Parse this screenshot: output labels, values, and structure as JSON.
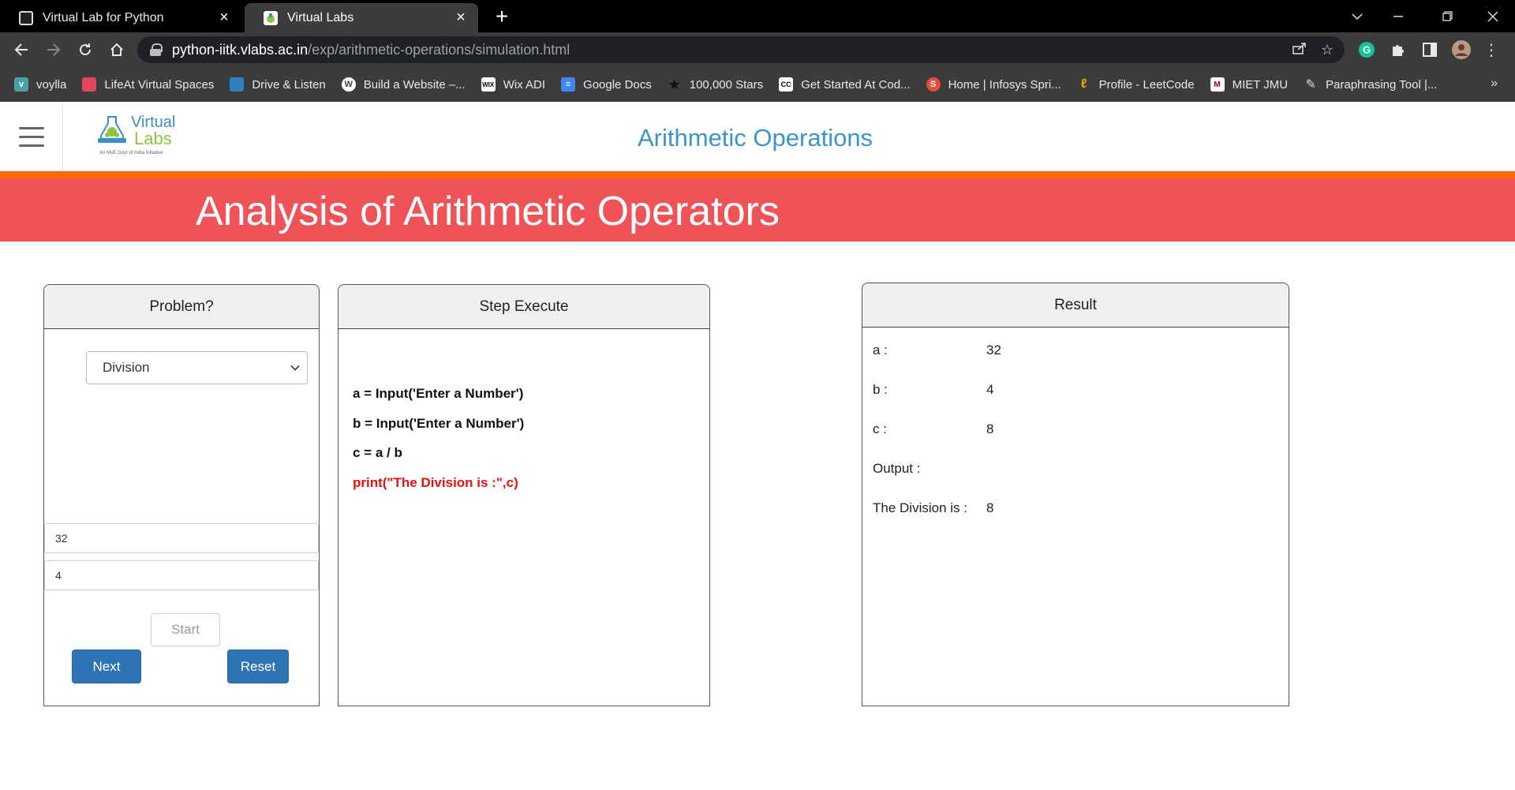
{
  "browser": {
    "tabs": [
      {
        "title": "Virtual Lab for Python",
        "active": false
      },
      {
        "title": "Virtual Labs",
        "active": true
      }
    ],
    "url_host": "python-iitk.vlabs.ac.in",
    "url_path": "/exp/arithmetic-operations/simulation.html",
    "bookmarks": [
      {
        "label": "voylla",
        "icon": "v-logo-icon",
        "color": "#4aa3a0"
      },
      {
        "label": "LifeAt Virtual Spaces",
        "icon": "lifeat-icon",
        "color": "#e0465e"
      },
      {
        "label": "Drive & Listen",
        "icon": "drive-listen-icon",
        "color": "#2f7fc1"
      },
      {
        "label": "Build a Website –...",
        "icon": "wordpress-icon",
        "color": "#ffffff"
      },
      {
        "label": "Wix ADI",
        "icon": "wix-icon",
        "color": "#ffffff"
      },
      {
        "label": "Google Docs",
        "icon": "google-docs-icon",
        "color": "#4285f4"
      },
      {
        "label": "100,000 Stars",
        "icon": "star-icon",
        "color": "#111111"
      },
      {
        "label": "Get Started At Cod...",
        "icon": "codecademy-icon",
        "color": "#ffffff"
      },
      {
        "label": "Home | Infosys Spri...",
        "icon": "infosys-icon",
        "color": "#e84c3d"
      },
      {
        "label": "Profile - LeetCode",
        "icon": "leetcode-icon",
        "color": "#f0a500"
      },
      {
        "label": "MIET JMU",
        "icon": "miet-icon",
        "color": "#ffffff"
      },
      {
        "label": "Paraphrasing Tool |...",
        "icon": "quill-icon",
        "color": "#dddddd"
      }
    ]
  },
  "site": {
    "logo_virtual": "Virtual",
    "logo_labs": "Labs",
    "logo_tagline": "An MoE Govt of India Initiative",
    "title": "Arithmetic Operations",
    "banner": "Analysis of Arithmetic Operators",
    "colors": {
      "accent_orange": "#ff6a00",
      "banner_red": "#ef5257",
      "title_blue": "#3a95c9",
      "button_blue": "#2e74b5",
      "highlight_red": "#e81010"
    }
  },
  "problem": {
    "header": "Problem?",
    "selected_operation": "Division",
    "input_a": "32",
    "input_b": "4",
    "start_label": "Start",
    "next_label": "Next",
    "reset_label": "Reset"
  },
  "step_execute": {
    "header": "Step Execute",
    "lines": [
      "a = Input('Enter a Number')",
      "b = Input('Enter a Number')",
      "c = a / b",
      "print(\"The Division is :\",c)"
    ],
    "highlighted_line": 3
  },
  "result": {
    "header": "Result",
    "rows": [
      {
        "label": "a :",
        "value": "32"
      },
      {
        "label": "b :",
        "value": "4"
      },
      {
        "label": "c :",
        "value": "8"
      },
      {
        "label": "Output :",
        "value": ""
      },
      {
        "label": "The Division is :",
        "value": "8"
      }
    ]
  }
}
